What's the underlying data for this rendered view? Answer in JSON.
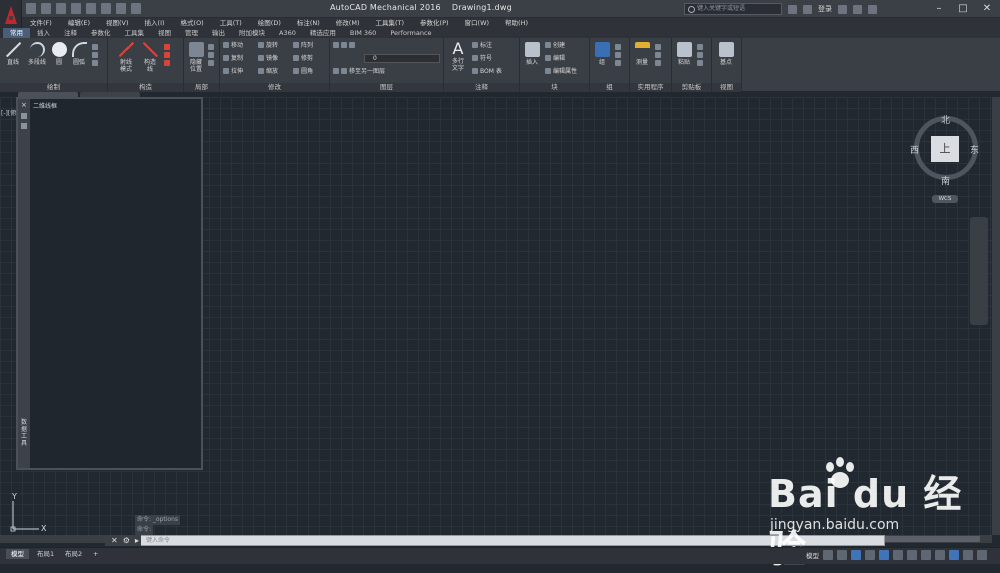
{
  "app": {
    "title": "AutoCAD Mechanical 2016",
    "drawing": "Drawing1.dwg",
    "search_placeholder": "键入关键字或短语",
    "login_label": "登录"
  },
  "menu": [
    "文件(F)",
    "编辑(E)",
    "视图(V)",
    "插入(I)",
    "格式(O)",
    "工具(T)",
    "绘图(D)",
    "标注(N)",
    "修改(M)",
    "工具集(T)",
    "参数化(P)",
    "窗口(W)",
    "帮助(H)"
  ],
  "ribbon_tabs": [
    "常用",
    "插入",
    "注释",
    "参数化",
    "工具集",
    "视图",
    "管理",
    "输出",
    "附加模块",
    "A360",
    "精选应用",
    "BIM 360",
    "Performance"
  ],
  "panels": {
    "draw": {
      "title": "绘制",
      "line": "直线",
      "polyline": "多段线",
      "circle": "圆",
      "arc": "圆弧"
    },
    "construct": {
      "title": "构造",
      "ray": "射线\n模式",
      "cline": "构造\n线"
    },
    "layout": {
      "title": "局部",
      "hide": "隐藏\n位置"
    },
    "modify": {
      "title": "修改",
      "move": "移动",
      "rotate": "旋转",
      "array": "阵列",
      "copy": "复制",
      "mirror": "镜像",
      "trim": "修剪",
      "stretch": "拉伸",
      "scale": "缩放",
      "fillet": "圆角"
    },
    "layers": {
      "title": "图层",
      "current": "0",
      "move_to": "移至另一图层"
    },
    "annotation": {
      "title": "注释",
      "mtext": "多行\n文字",
      "dim": "标注",
      "symbol": "符号",
      "bom": "BOM 表"
    },
    "block": {
      "title": "块",
      "insert": "插入",
      "create": "创建",
      "edit": "编辑",
      "edit_attr": "编辑属性"
    },
    "groups": {
      "title": "组",
      "group": "组"
    },
    "utilities": {
      "title": "实用程序",
      "measure": "测量"
    },
    "clipboard": {
      "title": "剪贴板",
      "paste": "粘贴"
    },
    "view": {
      "title": "视图",
      "base": "基点"
    }
  },
  "viewport": {
    "label": "[-][俯视][二维线框]",
    "palette_title": "二维线框",
    "palette_side": "数据工具",
    "cube_face": "上",
    "north": "北",
    "south": "南",
    "east": "东",
    "west": "西",
    "wcs": "WCS"
  },
  "command": {
    "history": [
      "命令: _options",
      "命令:"
    ],
    "placeholder": "键入命令"
  },
  "layout_tabs": [
    "模型",
    "布局1",
    "布局2",
    "+"
  ],
  "status": {
    "model": "模型"
  },
  "watermark": {
    "brand": "Bai du 经验",
    "url": "jingyan.baidu.com"
  },
  "colors": {
    "accent": "#c0282d",
    "canvas": "#212830",
    "active_tab": "#4a5e7a"
  }
}
